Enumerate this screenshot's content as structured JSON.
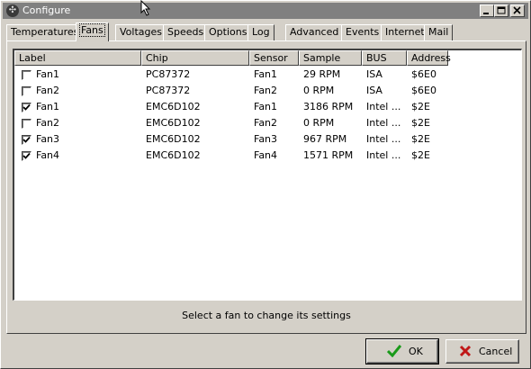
{
  "window": {
    "title": "Configure",
    "icon": "gear-icon",
    "controls": [
      "minimize",
      "maximize",
      "close"
    ]
  },
  "tabs": [
    {
      "label": "Temperatures",
      "active": false
    },
    {
      "label": "Fans",
      "active": true
    },
    {
      "label": "Voltages",
      "active": false
    },
    {
      "label": "Speeds",
      "active": false
    },
    {
      "label": "Options",
      "active": false
    },
    {
      "label": "Log",
      "active": false
    },
    {
      "label": "Advanced",
      "active": false
    },
    {
      "label": "Events",
      "active": false
    },
    {
      "label": "Internet",
      "active": false
    },
    {
      "label": "Mail",
      "active": false
    }
  ],
  "table": {
    "columns": [
      "Label",
      "Chip",
      "Sensor",
      "Sample",
      "BUS",
      "Address"
    ],
    "rows": [
      {
        "checked": false,
        "label": "Fan1",
        "chip": "PC87372",
        "sensor": "Fan1",
        "sample": "29 RPM",
        "bus": "ISA",
        "address": "$6E0"
      },
      {
        "checked": false,
        "label": "Fan2",
        "chip": "PC87372",
        "sensor": "Fan2",
        "sample": "0 RPM",
        "bus": "ISA",
        "address": "$6E0"
      },
      {
        "checked": true,
        "label": "Fan1",
        "chip": "EMC6D102",
        "sensor": "Fan1",
        "sample": "3186 RPM",
        "bus": "Intel ...",
        "address": "$2E"
      },
      {
        "checked": false,
        "label": "Fan2",
        "chip": "EMC6D102",
        "sensor": "Fan2",
        "sample": "0 RPM",
        "bus": "Intel ...",
        "address": "$2E"
      },
      {
        "checked": true,
        "label": "Fan3",
        "chip": "EMC6D102",
        "sensor": "Fan3",
        "sample": "967 RPM",
        "bus": "Intel ...",
        "address": "$2E"
      },
      {
        "checked": true,
        "label": "Fan4",
        "chip": "EMC6D102",
        "sensor": "Fan4",
        "sample": "1571 RPM",
        "bus": "Intel ...",
        "address": "$2E"
      }
    ]
  },
  "status_text": "Select a fan to change its settings",
  "buttons": {
    "ok_label": "OK",
    "cancel_label": "Cancel"
  },
  "colors": {
    "face": "#d4d0c8",
    "title_inactive": "#808080",
    "ok_check": "#1a9a1a",
    "cancel_x": "#c01818"
  }
}
